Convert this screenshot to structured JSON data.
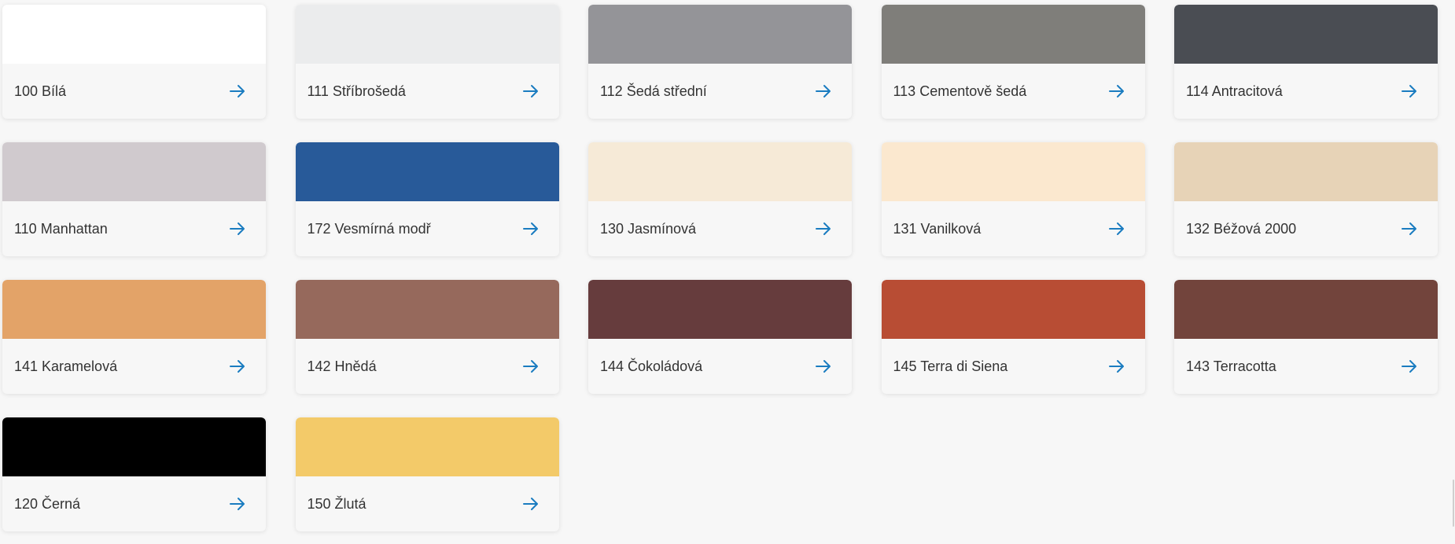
{
  "colors": [
    {
      "label": "100 Bílá",
      "swatch": "#ffffff"
    },
    {
      "label": "111 Stříbrošedá",
      "swatch": "#ebeced"
    },
    {
      "label": "112 Šedá střední",
      "swatch": "#949498"
    },
    {
      "label": "113 Cementově šedá",
      "swatch": "#7f7e7a"
    },
    {
      "label": "114 Antracitová",
      "swatch": "#4a4d53"
    },
    {
      "label": "110 Manhattan",
      "swatch": "#d0cace"
    },
    {
      "label": "172 Vesmírná modř",
      "swatch": "#285a99"
    },
    {
      "label": "130 Jasmínová",
      "swatch": "#f6ead7"
    },
    {
      "label": "131 Vanilková",
      "swatch": "#fbe8cf"
    },
    {
      "label": "132 Béžová 2000",
      "swatch": "#e7d3b7"
    },
    {
      "label": "141 Karamelová",
      "swatch": "#e3a368"
    },
    {
      "label": "142 Hnědá",
      "swatch": "#96695c"
    },
    {
      "label": "144 Čokoládová",
      "swatch": "#663c3d"
    },
    {
      "label": "145 Terra di Siena",
      "swatch": "#b84d34"
    },
    {
      "label": "143 Terracotta",
      "swatch": "#72443c"
    },
    {
      "label": "120 Černá",
      "swatch": "#000000"
    },
    {
      "label": "150 Žlutá",
      "swatch": "#f3ca69"
    }
  ],
  "theme": {
    "accent": "#1a7cc0",
    "text": "#333333",
    "background": "#f7f7f7"
  },
  "icons": {
    "card_action": "arrow-right-icon"
  }
}
